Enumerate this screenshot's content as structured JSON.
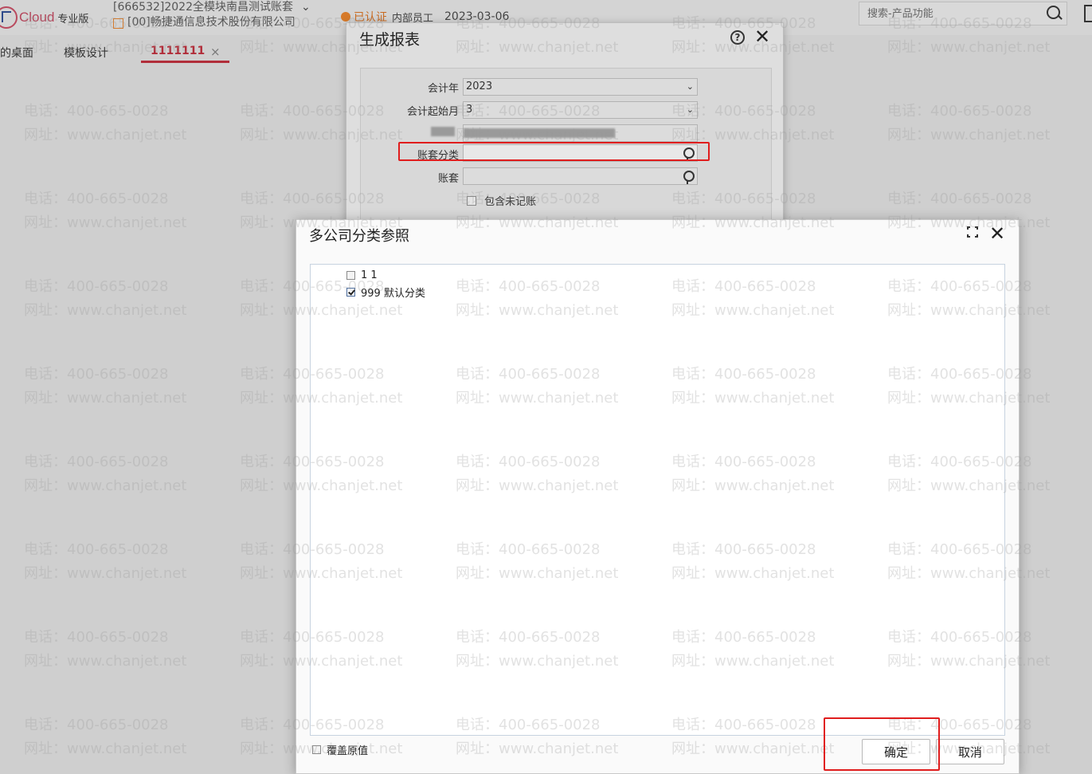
{
  "app": {
    "brand": "Cloud",
    "edition": "专业版"
  },
  "account": {
    "ledger": "[666532]2022全模块南昌测试账套",
    "company": "[00]畅捷通信息技术股份有限公司"
  },
  "status": {
    "auth": "已认证",
    "role": "内部员工",
    "date": "2023-03-06"
  },
  "search": {
    "placeholder": "搜索-产品功能"
  },
  "tabs": [
    {
      "label": "我的桌面"
    },
    {
      "label": "模板设计"
    },
    {
      "label": "1111111"
    }
  ],
  "tab_close": "×",
  "watermark": {
    "phone": "电话：400-665-0028",
    "site": "网址：www.chanjet.net"
  },
  "report_dialog": {
    "title": "生成报表",
    "close": "✕",
    "help": "?",
    "fields": {
      "fiscal_year_label": "会计年",
      "fiscal_year_value": "2023",
      "start_month_label": "会计起始月",
      "start_month_value": "3",
      "ledger_category_label": "账套分类",
      "ledger_category_value": "",
      "ledger_label": "账套",
      "ledger_value": ""
    },
    "include_unposted": "包含未记账",
    "caret": "⌄"
  },
  "category_dialog": {
    "title": "多公司分类参照",
    "close": "✕",
    "items": [
      {
        "label": "1 1",
        "checked": false
      },
      {
        "label": "999 默认分类",
        "checked": true
      }
    ],
    "overwrite_label": "覆盖原值",
    "ok_label": "确定",
    "cancel_label": "取消"
  }
}
